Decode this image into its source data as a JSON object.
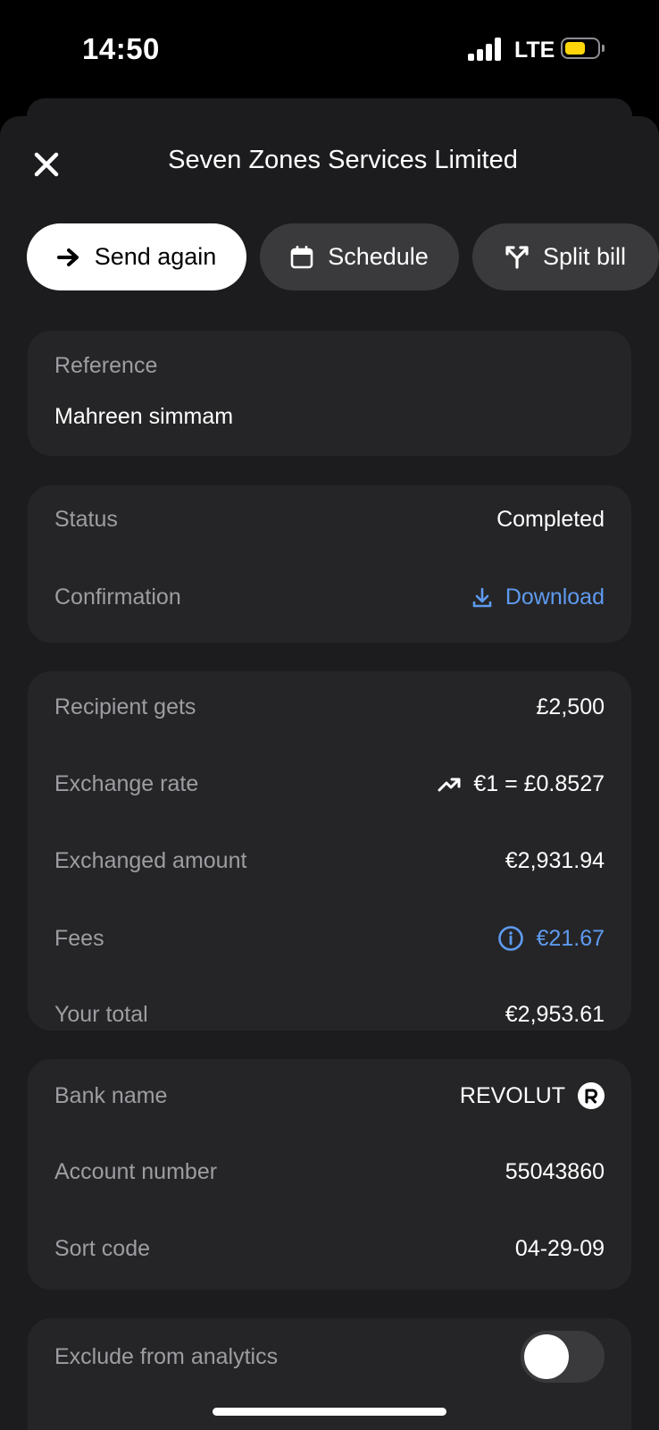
{
  "status_bar": {
    "time": "14:50",
    "network": "LTE",
    "battery_color": "#ffd60a"
  },
  "header": {
    "title": "Seven Zones Services Limited",
    "close_icon": "close-icon"
  },
  "actions": [
    {
      "label": "Send again",
      "icon": "arrow-right-icon"
    },
    {
      "label": "Schedule",
      "icon": "calendar-icon"
    },
    {
      "label": "Split bill",
      "icon": "split-icon"
    }
  ],
  "reference": {
    "label": "Reference",
    "value": "Mahreen simmam"
  },
  "status_card": {
    "status_label": "Status",
    "status_value": "Completed",
    "confirmation_label": "Confirmation",
    "download_label": "Download"
  },
  "amount_card": {
    "recipient_label": "Recipient gets",
    "recipient_value": "£2,500",
    "rate_label": "Exchange rate",
    "rate_value": "€1 = £0.8527",
    "exchanged_label": "Exchanged amount",
    "exchanged_value": "€2,931.94",
    "fees_label": "Fees",
    "fees_value": "€21.67",
    "total_label": "Your total",
    "total_value": "€2,953.61"
  },
  "bank_card": {
    "bank_label": "Bank name",
    "bank_value": "REVOLUT",
    "account_label": "Account number",
    "account_value": "55043860",
    "sort_label": "Sort code",
    "sort_value": "04-29-09"
  },
  "analytics": {
    "label": "Exclude from analytics",
    "enabled": false
  },
  "colors": {
    "accent_blue": "#5e9bf0",
    "card_bg": "#252527",
    "sheet_bg": "#1c1c1e"
  }
}
